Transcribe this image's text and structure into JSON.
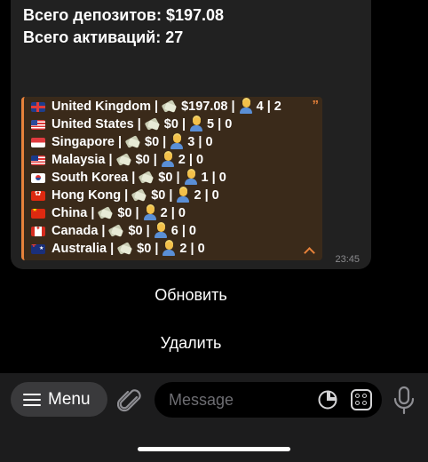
{
  "message": {
    "totals": [
      "Всего депозитов: $197.08",
      "Всего активаций: 27"
    ],
    "quote_mark": "”",
    "countries": [
      {
        "flag": "gb",
        "name": "United Kingdom",
        "deposits": "$197.08",
        "activations": "4",
        "extra": "2"
      },
      {
        "flag": "us",
        "name": "United States",
        "deposits": "$0",
        "activations": "5",
        "extra": "0"
      },
      {
        "flag": "sg",
        "name": "Singapore",
        "deposits": "$0",
        "activations": "3",
        "extra": "0"
      },
      {
        "flag": "my",
        "name": "Malaysia",
        "deposits": "$0",
        "activations": "2",
        "extra": "0"
      },
      {
        "flag": "kr",
        "name": "South Korea",
        "deposits": "$0",
        "activations": "1",
        "extra": "0"
      },
      {
        "flag": "hk",
        "name": "Hong Kong",
        "deposits": "$0",
        "activations": "2",
        "extra": "0"
      },
      {
        "flag": "cn",
        "name": "China",
        "deposits": "$0",
        "activations": "2",
        "extra": "0"
      },
      {
        "flag": "ca",
        "name": "Canada",
        "deposits": "$0",
        "activations": "6",
        "extra": "0"
      },
      {
        "flag": "au",
        "name": "Australia",
        "deposits": "$0",
        "activations": "2",
        "extra": "0"
      }
    ],
    "separator": "|",
    "time": "23:45"
  },
  "keyboard": {
    "refresh_label": "Обновить",
    "delete_label": "Удалить"
  },
  "input_bar": {
    "menu_label": "Menu",
    "message_placeholder": "Message"
  },
  "colors": {
    "accent": "#e8823a",
    "bubble": "#212121",
    "quote_bg": "#3a2a1a",
    "bar": "#1c1c1d"
  }
}
